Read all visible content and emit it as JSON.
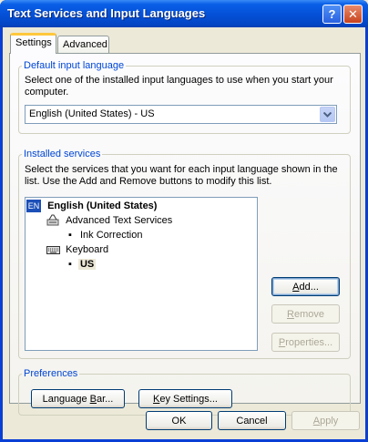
{
  "window": {
    "title": "Text Services and Input Languages",
    "help_glyph": "?",
    "close_glyph": "✕"
  },
  "tabs": [
    {
      "label": "Settings",
      "active": true
    },
    {
      "label": "Advanced",
      "active": false
    }
  ],
  "default_language": {
    "legend": "Default input language",
    "description_line1": "Select one of the installed input languages to use when you start your",
    "description_line2": "computer.",
    "selected": "English (United States) - US",
    "arrow_icon": "chevron-down-icon"
  },
  "installed_services": {
    "legend": "Installed services",
    "description_line1": "Select the services that you want for each input language shown in the",
    "description_line2": "list. Use the Add and Remove buttons to modify this list.",
    "tree": {
      "language_badge": "EN",
      "language": "English (United States)",
      "categories": [
        {
          "label": "Advanced Text Services",
          "icon": "text-services-icon",
          "items": [
            "Ink Correction"
          ]
        },
        {
          "label": "Keyboard",
          "icon": "keyboard-icon",
          "items": [
            "US"
          ]
        }
      ],
      "bullet": "▪"
    },
    "buttons": {
      "add_prefix": "",
      "add_mnemonic": "A",
      "add_rest": "dd...",
      "remove_prefix": "",
      "remove_mnemonic": "R",
      "remove_rest": "emove",
      "properties_prefix": "",
      "properties_mnemonic": "P",
      "properties_rest": "roperties..."
    }
  },
  "preferences": {
    "legend": "Preferences",
    "language_bar_prefix": "Language ",
    "language_bar_mnemonic": "B",
    "language_bar_rest": "ar...",
    "key_settings_prefix": "",
    "key_settings_mnemonic": "K",
    "key_settings_rest": "ey Settings..."
  },
  "footer": {
    "ok": "OK",
    "cancel": "Cancel",
    "apply_mnemonic": "A",
    "apply_rest": "pply"
  }
}
